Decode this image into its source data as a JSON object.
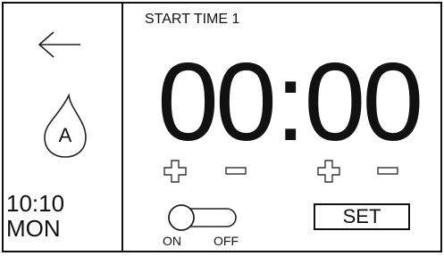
{
  "title": "START TIME 1",
  "time": {
    "hours": "00",
    "separator": ":",
    "minutes": "00"
  },
  "left_panel": {
    "flame_label": "A",
    "clock_time": "10:10",
    "clock_day": "MON"
  },
  "toggle": {
    "on_label": "ON",
    "off_label": "OFF",
    "state": "on"
  },
  "set_label": "SET",
  "icons": {
    "back": "arrow-left-icon",
    "flame": "flame-icon",
    "increase": "plus-icon",
    "decrease": "minus-icon"
  }
}
